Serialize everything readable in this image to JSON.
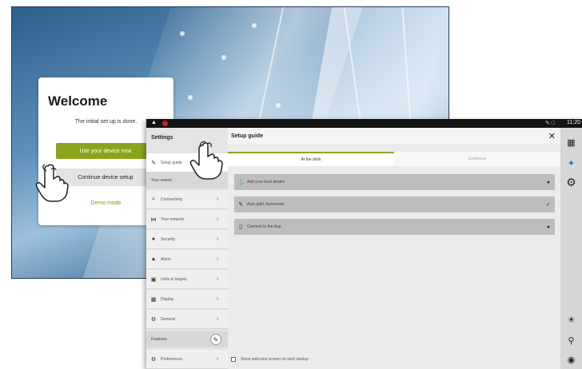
{
  "welcome": {
    "title": "Welcome",
    "subtitle": "The initial set up is done.",
    "primary_button": "Use your device now",
    "secondary_button": "Continue device setup",
    "demo_link": "Demo mode"
  },
  "status_bar": {
    "left_icon": "compass-icon",
    "time": "11:20"
  },
  "settings": {
    "title": "Settings",
    "items": [
      {
        "label": "Setup guide",
        "icon": "wrench-icon"
      },
      {
        "label": "Connectivity",
        "icon": "wifi-icon"
      },
      {
        "label": "Your network",
        "icon": "network-icon"
      },
      {
        "label": "Security",
        "icon": "shield-icon"
      },
      {
        "label": "Alerts",
        "icon": "warning-icon"
      },
      {
        "label": "Units & targets",
        "icon": "units-icon"
      },
      {
        "label": "Display",
        "icon": "display-icon"
      },
      {
        "label": "General",
        "icon": "gear-icon"
      },
      {
        "label": "Preferences",
        "icon": "preferences-icon"
      }
    ],
    "section_label": "Your vessel",
    "section_label_2": "Features"
  },
  "setup_guide": {
    "title": "Setup guide",
    "tabs": [
      "At the dock",
      "Underway"
    ],
    "rows": [
      {
        "label": "Add your boat details",
        "icon": "boat-icon",
        "status": "lock-icon"
      },
      {
        "label": "Auto pilot: Autorotate",
        "icon": "wrench-icon",
        "status": "check-icon"
      },
      {
        "label": "Connect to the App",
        "icon": "phone-icon",
        "status": "lock-icon"
      }
    ],
    "footer_checkbox": "Show welcome screen on next startup"
  },
  "colors": {
    "accent": "#8aa51c",
    "status_red": "#c8231e"
  }
}
